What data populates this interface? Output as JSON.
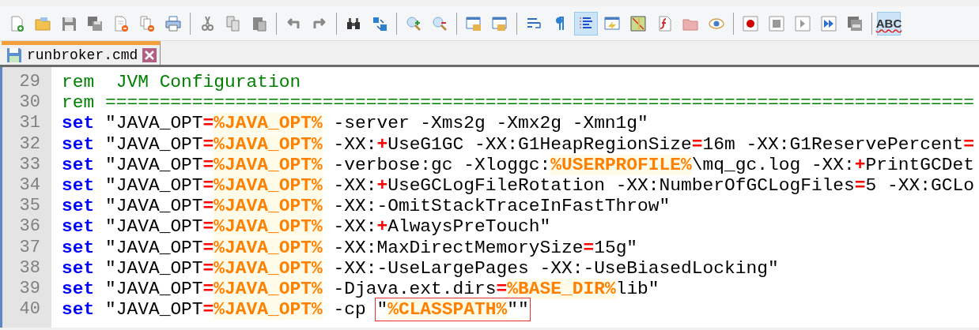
{
  "toolbar": [
    {
      "buttons": [
        {
          "selected": false
        },
        {
          "selected": false
        },
        {
          "selected": false
        },
        {
          "selected": false
        },
        {
          "selected": false
        },
        {
          "selected": false
        },
        {
          "selected": false
        }
      ]
    },
    {
      "buttons": [
        {
          "selected": false
        },
        {
          "selected": false
        },
        {
          "selected": false
        }
      ]
    },
    {
      "buttons": [
        {
          "selected": false
        },
        {
          "selected": false
        }
      ]
    },
    {
      "buttons": [
        {
          "selected": false
        },
        {
          "selected": false
        }
      ]
    },
    {
      "buttons": [
        {
          "selected": false
        },
        {
          "selected": false
        }
      ]
    },
    {
      "buttons": [
        {
          "selected": false
        },
        {
          "selected": false
        }
      ]
    },
    {
      "buttons": [
        {
          "selected": false
        },
        {
          "selected": false
        },
        {
          "selected": true
        },
        {
          "selected": false
        },
        {
          "selected": false
        },
        {
          "selected": false
        },
        {
          "selected": false
        },
        {
          "selected": false
        }
      ]
    },
    {
      "buttons": [
        {
          "selected": false
        },
        {
          "selected": false
        },
        {
          "selected": false
        },
        {
          "selected": false
        },
        {
          "selected": false
        }
      ]
    },
    {
      "buttons": [
        {
          "selected": true,
          "label": "ABC"
        }
      ]
    }
  ],
  "tabs": [
    {
      "label": "runbroker.cmd",
      "selected": true
    }
  ],
  "lines": [
    {
      "number": "29",
      "segments": [
        {
          "kind": "comment",
          "text": "rem  JVM Configuration"
        }
      ]
    },
    {
      "number": "30",
      "segments": [
        {
          "kind": "comment",
          "text": "rem ================================================================================"
        }
      ]
    },
    {
      "number": "31",
      "segments": [
        {
          "kind": "keyword",
          "text": "set"
        },
        {
          "kind": "plain",
          "text": " \"JAVA_OPT"
        },
        {
          "kind": "operator",
          "text": "="
        },
        {
          "kind": "variable",
          "text": "%JAVA_OPT%"
        },
        {
          "kind": "plain",
          "text": " -server -Xms2g -Xmx2g -Xmn1g\""
        }
      ]
    },
    {
      "number": "32",
      "segments": [
        {
          "kind": "keyword",
          "text": "set"
        },
        {
          "kind": "plain",
          "text": " \"JAVA_OPT"
        },
        {
          "kind": "operator",
          "text": "="
        },
        {
          "kind": "variable",
          "text": "%JAVA_OPT%"
        },
        {
          "kind": "plain",
          "text": " -XX:"
        },
        {
          "kind": "operator",
          "text": "+"
        },
        {
          "kind": "plain",
          "text": "UseG1GC -XX:G1HeapRegionSize"
        },
        {
          "kind": "operator",
          "text": "="
        },
        {
          "kind": "plain",
          "text": "16m -XX:G1ReservePercent"
        },
        {
          "kind": "operator",
          "text": "="
        }
      ]
    },
    {
      "number": "33",
      "segments": [
        {
          "kind": "keyword",
          "text": "set"
        },
        {
          "kind": "plain",
          "text": " \"JAVA_OPT"
        },
        {
          "kind": "operator",
          "text": "="
        },
        {
          "kind": "variable",
          "text": "%JAVA_OPT%"
        },
        {
          "kind": "plain",
          "text": " -verbose:gc -Xloggc:"
        },
        {
          "kind": "variable",
          "text": "%USERPROFILE%"
        },
        {
          "kind": "plain",
          "text": "\\mq_gc.log -XX:"
        },
        {
          "kind": "operator",
          "text": "+"
        },
        {
          "kind": "plain",
          "text": "PrintGCDet"
        }
      ]
    },
    {
      "number": "34",
      "segments": [
        {
          "kind": "keyword",
          "text": "set"
        },
        {
          "kind": "plain",
          "text": " \"JAVA_OPT"
        },
        {
          "kind": "operator",
          "text": "="
        },
        {
          "kind": "variable",
          "text": "%JAVA_OPT%"
        },
        {
          "kind": "plain",
          "text": " -XX:"
        },
        {
          "kind": "operator",
          "text": "+"
        },
        {
          "kind": "plain",
          "text": "UseGCLogFileRotation -XX:NumberOfGCLogFiles"
        },
        {
          "kind": "operator",
          "text": "="
        },
        {
          "kind": "plain",
          "text": "5 -XX:GCLo"
        }
      ]
    },
    {
      "number": "35",
      "segments": [
        {
          "kind": "keyword",
          "text": "set"
        },
        {
          "kind": "plain",
          "text": " \"JAVA_OPT"
        },
        {
          "kind": "operator",
          "text": "="
        },
        {
          "kind": "variable",
          "text": "%JAVA_OPT%"
        },
        {
          "kind": "plain",
          "text": " -XX:-OmitStackTraceInFastThrow\""
        }
      ]
    },
    {
      "number": "36",
      "segments": [
        {
          "kind": "keyword",
          "text": "set"
        },
        {
          "kind": "plain",
          "text": " \"JAVA_OPT"
        },
        {
          "kind": "operator",
          "text": "="
        },
        {
          "kind": "variable",
          "text": "%JAVA_OPT%"
        },
        {
          "kind": "plain",
          "text": " -XX:"
        },
        {
          "kind": "operator",
          "text": "+"
        },
        {
          "kind": "plain",
          "text": "AlwaysPreTouch\""
        }
      ]
    },
    {
      "number": "37",
      "segments": [
        {
          "kind": "keyword",
          "text": "set"
        },
        {
          "kind": "plain",
          "text": " \"JAVA_OPT"
        },
        {
          "kind": "operator",
          "text": "="
        },
        {
          "kind": "variable",
          "text": "%JAVA_OPT%"
        },
        {
          "kind": "plain",
          "text": " -XX:MaxDirectMemorySize"
        },
        {
          "kind": "operator",
          "text": "="
        },
        {
          "kind": "plain",
          "text": "15g\""
        }
      ]
    },
    {
      "number": "38",
      "segments": [
        {
          "kind": "keyword",
          "text": "set"
        },
        {
          "kind": "plain",
          "text": " \"JAVA_OPT"
        },
        {
          "kind": "operator",
          "text": "="
        },
        {
          "kind": "variable",
          "text": "%JAVA_OPT%"
        },
        {
          "kind": "plain",
          "text": " -XX:-UseLargePages -XX:-UseBiasedLocking\""
        }
      ]
    },
    {
      "number": "39",
      "segments": [
        {
          "kind": "keyword",
          "text": "set"
        },
        {
          "kind": "plain",
          "text": " \"JAVA_OPT"
        },
        {
          "kind": "operator",
          "text": "="
        },
        {
          "kind": "variable",
          "text": "%JAVA_OPT%"
        },
        {
          "kind": "plain",
          "text": " -Djava.ext.dirs"
        },
        {
          "kind": "operator",
          "text": "="
        },
        {
          "kind": "variable",
          "text": "%BASE_DIR%"
        },
        {
          "kind": "plain",
          "text": "lib\""
        }
      ]
    },
    {
      "number": "40",
      "segments": [
        {
          "kind": "keyword",
          "text": "set"
        },
        {
          "kind": "plain",
          "text": " \"JAVA_OPT"
        },
        {
          "kind": "operator",
          "text": "="
        },
        {
          "kind": "variable",
          "text": "%JAVA_OPT%"
        },
        {
          "kind": "plain",
          "text": " -cp "
        },
        {
          "kind": "plain",
          "text": "\"",
          "annotated": true
        },
        {
          "kind": "variable",
          "text": "%CLASSPATH%",
          "annotated": true
        },
        {
          "kind": "plain",
          "text": "\"\"",
          "annotated": true
        }
      ]
    }
  ]
}
